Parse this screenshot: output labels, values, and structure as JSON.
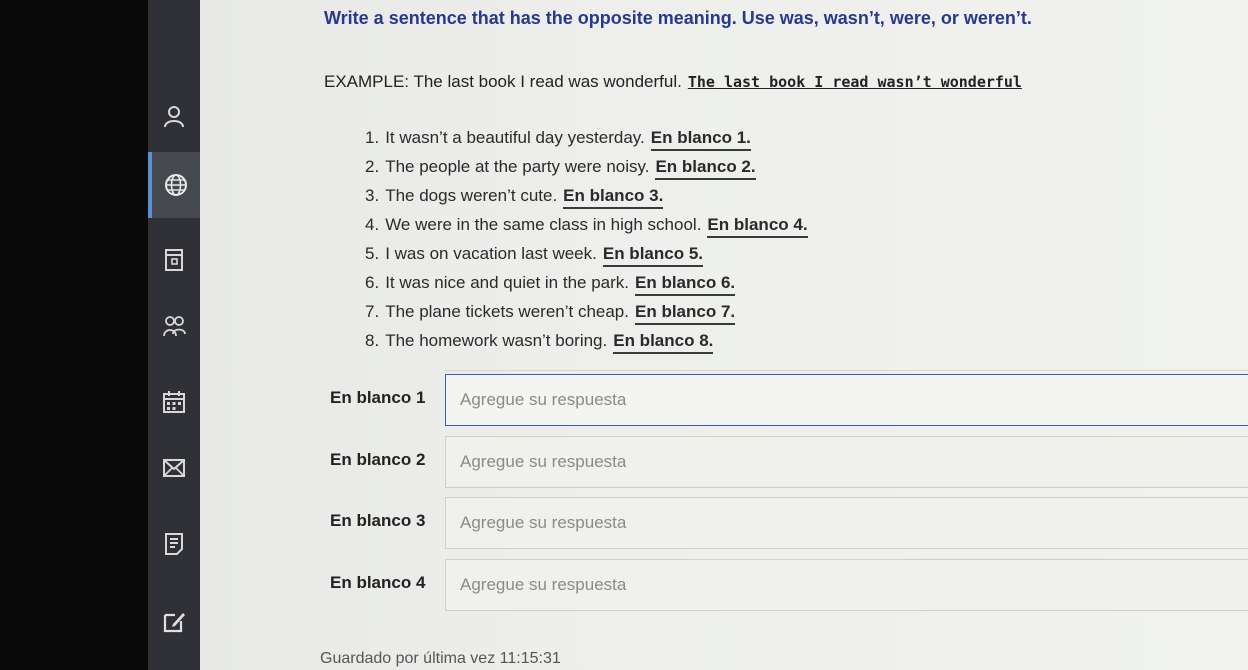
{
  "sidebar": {
    "items": [
      {
        "icon": "person-icon"
      },
      {
        "icon": "globe-icon",
        "active": true
      },
      {
        "icon": "document-icon"
      },
      {
        "icon": "people-icon"
      },
      {
        "icon": "calendar-icon"
      },
      {
        "icon": "inbox-icon"
      },
      {
        "icon": "notes-icon"
      },
      {
        "icon": "edit-icon"
      }
    ]
  },
  "exercise": {
    "instructions": "Write a sentence that has the opposite meaning. Use was, wasn’t, were, or weren’t.",
    "example_prefix": "EXAMPLE: The last book I read was wonderful.",
    "example_answer": "The last book I read wasn’t wonderful",
    "items": [
      {
        "num": "1.",
        "text": "It wasn’t a beautiful day yesterday.",
        "blank": "En blanco 1."
      },
      {
        "num": "2.",
        "text": "The people at the party were noisy.",
        "blank": "En blanco 2."
      },
      {
        "num": "3.",
        "text": "The dogs weren’t cute.",
        "blank": "En blanco 3."
      },
      {
        "num": "4.",
        "text": "We were in the same class in high school.",
        "blank": "En blanco 4."
      },
      {
        "num": "5.",
        "text": "I was on vacation last week.",
        "blank": "En blanco 5."
      },
      {
        "num": "6.",
        "text": "It was nice and quiet in the park.",
        "blank": "En blanco 6."
      },
      {
        "num": "7.",
        "text": "The plane tickets weren’t cheap.",
        "blank": "En blanco 7."
      },
      {
        "num": "8.",
        "text": "The homework wasn’t boring.",
        "blank": "En blanco 8."
      }
    ]
  },
  "answers": [
    {
      "label": "En blanco 1",
      "placeholder": "Agregue su respuesta",
      "value": ""
    },
    {
      "label": "En blanco 2",
      "placeholder": "Agregue su respuesta",
      "value": ""
    },
    {
      "label": "En blanco 3",
      "placeholder": "Agregue su respuesta",
      "value": ""
    },
    {
      "label": "En blanco 4",
      "placeholder": "Agregue su respuesta",
      "value": ""
    }
  ],
  "footer": {
    "saved_text": "Guardado por última vez 11:15:31"
  }
}
